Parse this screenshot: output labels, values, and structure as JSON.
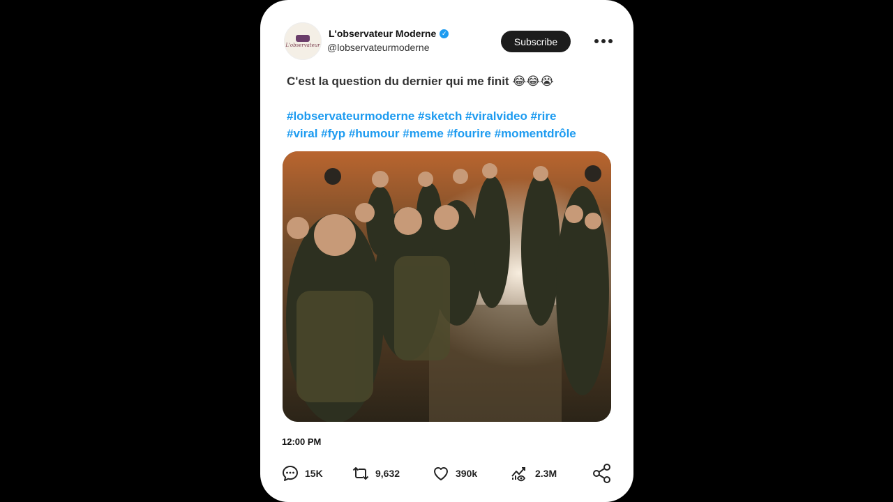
{
  "post": {
    "display_name": "L'observateur Moderne",
    "handle": "@lobservateurmoderne",
    "avatar_text": "L'observateur",
    "verified_glyph": "✓",
    "subscribe_label": "Subscribe",
    "text": "C'est la question du dernier qui me finit 😂😂😭",
    "hashtags_line1": "#lobservateurmoderne #sketch #viralvideo #rire",
    "hashtags_line2": "#viral #fyp #humour #meme #fourire #momentdrôle",
    "time": "12:00 PM"
  },
  "actions": {
    "replies": "15K",
    "reposts": "9,632",
    "likes": "390k",
    "views": "2.3M"
  },
  "icons": {
    "reply": "comment-icon",
    "repost": "repost-icon",
    "like": "heart-icon",
    "views": "analytics-icon",
    "share": "share-icon",
    "more": "more-dots-icon",
    "verified": "verified-badge-icon"
  },
  "colors": {
    "accent": "#1d9bf0",
    "subscribe_bg": "#1c1c1c",
    "card_bg": "#ffffff",
    "page_bg": "#000000"
  }
}
